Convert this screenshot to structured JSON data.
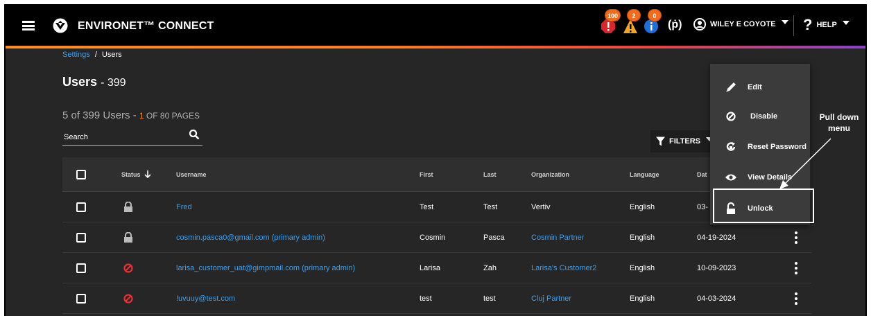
{
  "header": {
    "app_title": "ENVIRONET™ CONNECT",
    "alerts": [
      {
        "icon": "critical-alert-icon",
        "count": "100",
        "color": "#d9262c"
      },
      {
        "icon": "warning-alert-icon",
        "count": "2",
        "color": "#f5a623"
      },
      {
        "icon": "info-alert-icon",
        "count": "0",
        "color": "#1e6fd9"
      }
    ],
    "wifi_icon": "(ṗ)",
    "user_name": "WILEY E COYOTE",
    "help_label": "HELP",
    "help_symbol": "?"
  },
  "breadcrumb": {
    "settings": "Settings",
    "separator": "/",
    "current": "Users"
  },
  "page_title": "Users",
  "page_title_count": "- 399",
  "paging": {
    "summary": "5 of 399 Users - ",
    "page": "1",
    "of_pages": " OF 80 PAGES"
  },
  "search": {
    "label": "Search"
  },
  "filters": {
    "label": "FILTERS"
  },
  "table": {
    "headers": {
      "status": "Status",
      "username": "Username",
      "first": "First",
      "last": "Last",
      "organization": "Organization",
      "language": "Language",
      "date": "Dat"
    },
    "rows": [
      {
        "status": "locked",
        "username": "Fred",
        "first": "Test",
        "last": "Test",
        "organization": "Vertiv",
        "org_link": false,
        "language": "English",
        "date": "03-"
      },
      {
        "status": "locked",
        "username": "cosmin.pasca0@gmail.com (primary admin)",
        "first": "Cosmin",
        "last": "Pasca",
        "organization": "Cosmin Partner",
        "org_link": true,
        "language": "English",
        "date": "04-19-2024"
      },
      {
        "status": "disabled",
        "username": "larisa_customer_uat@gimpmail.com (primary admin)",
        "first": "Larisa",
        "last": "Zah",
        "organization": "Larisa's Customer2",
        "org_link": true,
        "language": "English",
        "date": "10-09-2023"
      },
      {
        "status": "disabled",
        "username": "!uvuuy@test.com",
        "first": "test",
        "last": "test",
        "organization": "Cluj Partner",
        "org_link": true,
        "language": "English",
        "date": "04-03-2024"
      }
    ]
  },
  "menu": {
    "items": [
      {
        "label": "Edit",
        "icon": "pencil-icon"
      },
      {
        "label": "Disable",
        "icon": "disable-icon"
      },
      {
        "label": "Reset Password",
        "icon": "reset-password-icon"
      },
      {
        "label": "View Details",
        "icon": "eye-icon"
      },
      {
        "label": "Unlock",
        "icon": "unlock-icon"
      }
    ]
  },
  "annotation": {
    "text": "Pull down menu"
  }
}
